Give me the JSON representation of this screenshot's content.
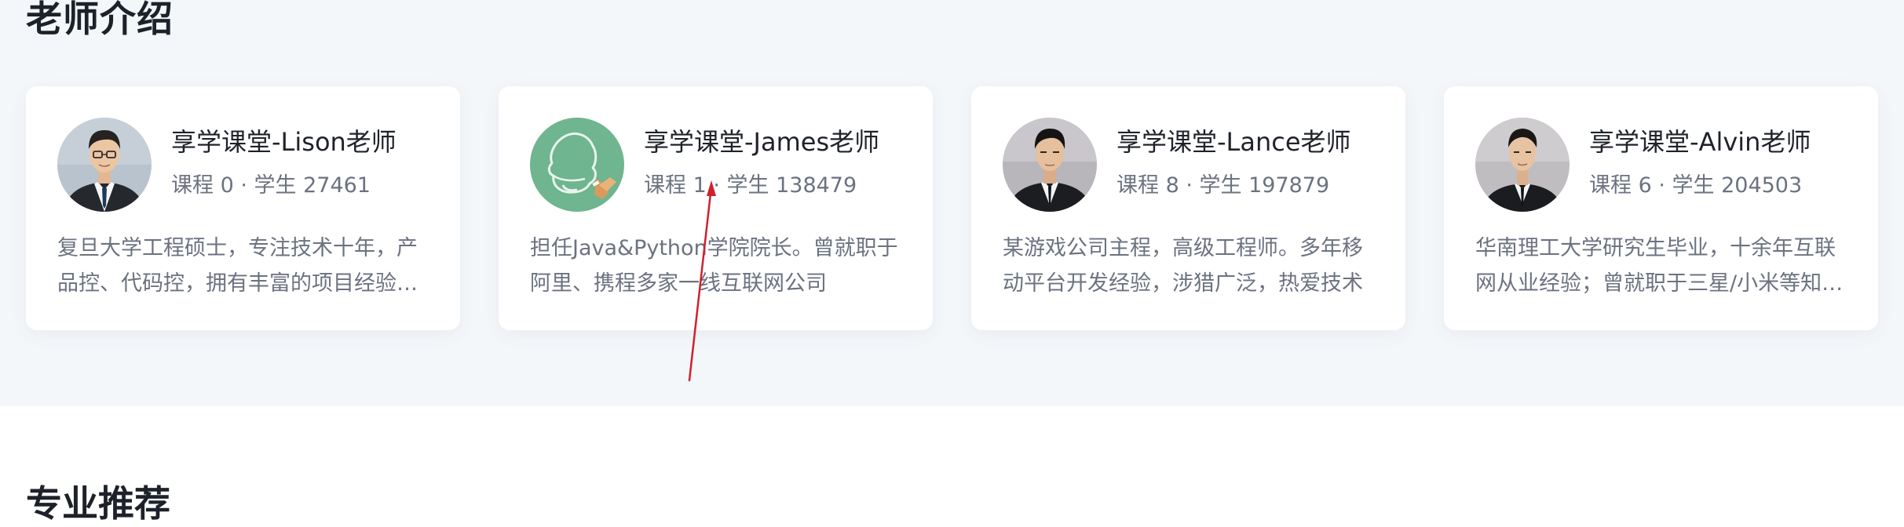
{
  "section": {
    "title": "老师介绍"
  },
  "teachers": [
    {
      "name": "享学课堂-Lison老师",
      "stats": "课程 0 · 学生 27461",
      "description": "复旦大学工程硕士，专注技术十年，产品控、代码控，拥有丰富的项目经验和团队管理经验"
    },
    {
      "name": "享学课堂-James老师",
      "stats": "课程 1 · 学生 138479",
      "description": "担任Java&Python学院院长。曾就职于阿里、携程多家一线互联网公司"
    },
    {
      "name": "享学课堂-Lance老师",
      "stats": "课程 8 · 学生 197879",
      "description": "某游戏公司主程，高级工程师。多年移动平台开发经验，涉猎广泛，热爱技术"
    },
    {
      "name": "享学课堂-Alvin老师",
      "stats": "课程 6 · 学生 204503",
      "description": "华南理工大学研究生毕业，十余年互联网从业经验；曾就职于三星/小米等知名企业"
    }
  ],
  "next_section": {
    "title": "专业推荐"
  },
  "colors": {
    "section_background": "#f4f7fa",
    "card_background": "#ffffff",
    "title_text": "#1d2129",
    "secondary_text": "#6b7280",
    "annotation_arrow": "#d01f2d",
    "default_avatar_background": "#6fb58f"
  },
  "icons": {
    "default_avatar": "qq-penguin-chalk-icon"
  }
}
